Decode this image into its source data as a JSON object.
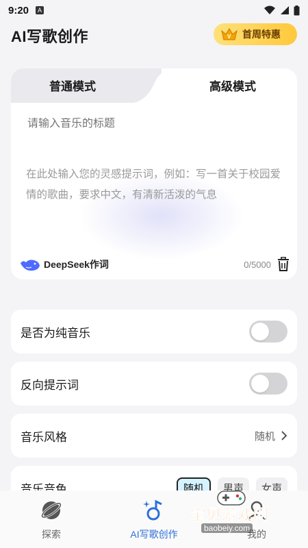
{
  "status_bar": {
    "time": "9:20",
    "badge": "A"
  },
  "header": {
    "title": "AI写歌创作",
    "promo_label": "首周特惠",
    "promo_color": "#ffc93b"
  },
  "editor": {
    "tabs": [
      {
        "label": "普通模式",
        "active": false
      },
      {
        "label": "高级模式",
        "active": true
      }
    ],
    "title_placeholder": "请输入音乐的标题",
    "prompt_placeholder": "在此处输入您的灵感提示词，例如：写一首关于校园爱情的歌曲，要求中文，有清新活泼的气息",
    "lyric_engine": "DeepSeek作词",
    "char_count": "0/5000"
  },
  "settings": {
    "pure_music": {
      "label": "是否为纯音乐",
      "enabled": false
    },
    "negative_prompt": {
      "label": "反向提示词",
      "enabled": false
    },
    "style": {
      "label": "音乐风格",
      "value": "随机"
    },
    "voice": {
      "label": "音乐音色",
      "options": [
        "随机",
        "男声",
        "女声"
      ],
      "selected": "随机"
    }
  },
  "bottom_nav": {
    "items": [
      {
        "label": "探索",
        "icon": "planet-icon"
      },
      {
        "label": "AI写歌创作",
        "icon": "music-sparkle-icon",
        "active": true
      },
      {
        "label": "我的",
        "icon": "user-icon"
      }
    ],
    "accent": "#2d6fd8"
  },
  "watermark": {
    "title": "宝贝游戏网",
    "url": "baobeiy.com"
  }
}
